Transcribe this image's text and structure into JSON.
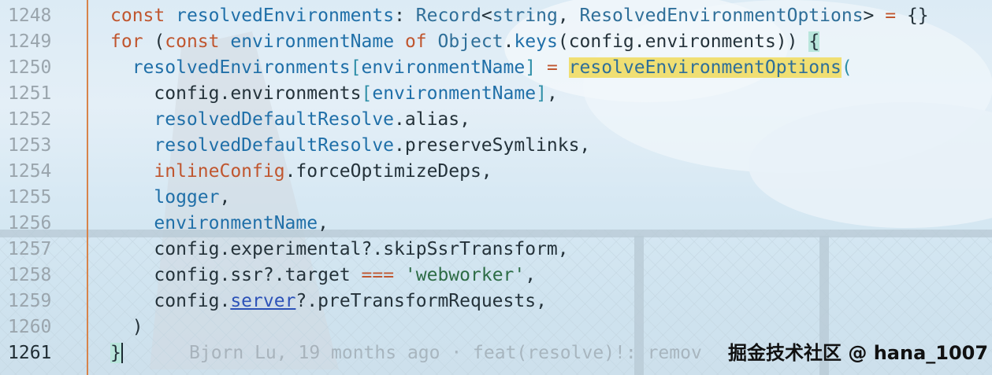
{
  "editor": {
    "lines": [
      {
        "num": "1248",
        "tokens": [
          {
            "t": "const",
            "c": "kw"
          },
          {
            "t": " ",
            "c": "pl"
          },
          {
            "t": "resolvedEnvironments",
            "c": "id"
          },
          {
            "t": ": ",
            "c": "pl"
          },
          {
            "t": "Record",
            "c": "tp"
          },
          {
            "t": "<",
            "c": "pl"
          },
          {
            "t": "string",
            "c": "tp"
          },
          {
            "t": ", ",
            "c": "pl"
          },
          {
            "t": "ResolvedEnvironmentOptions",
            "c": "tp"
          },
          {
            "t": "> ",
            "c": "pl"
          },
          {
            "t": "=",
            "c": "op"
          },
          {
            "t": " {}",
            "c": "pl"
          }
        ]
      },
      {
        "num": "1249",
        "tokens": [
          {
            "t": "for",
            "c": "kw"
          },
          {
            "t": " (",
            "c": "pl"
          },
          {
            "t": "const",
            "c": "kw"
          },
          {
            "t": " ",
            "c": "pl"
          },
          {
            "t": "environmentName",
            "c": "id"
          },
          {
            "t": " ",
            "c": "pl"
          },
          {
            "t": "of",
            "c": "kw"
          },
          {
            "t": " ",
            "c": "pl"
          },
          {
            "t": "Object",
            "c": "tp"
          },
          {
            "t": ".",
            "c": "pl"
          },
          {
            "t": "keys",
            "c": "id"
          },
          {
            "t": "(config.environments)) ",
            "c": "pl"
          },
          {
            "t": "{",
            "c": "bm"
          }
        ]
      },
      {
        "num": "1250",
        "tokens": [
          {
            "t": "  resolvedEnvironments",
            "c": "id"
          },
          {
            "t": "[",
            "c": "br"
          },
          {
            "t": "environmentName",
            "c": "id"
          },
          {
            "t": "]",
            "c": "br"
          },
          {
            "t": " ",
            "c": "pl"
          },
          {
            "t": "=",
            "c": "op"
          },
          {
            "t": " ",
            "c": "pl"
          },
          {
            "t": "resolveEnvironmentOptions",
            "c": "hl"
          },
          {
            "t": "(",
            "c": "br"
          }
        ]
      },
      {
        "num": "1251",
        "tokens": [
          {
            "t": "    config.environments",
            "c": "pl"
          },
          {
            "t": "[",
            "c": "br"
          },
          {
            "t": "environmentName",
            "c": "id"
          },
          {
            "t": "]",
            "c": "br"
          },
          {
            "t": ",",
            "c": "pl"
          }
        ]
      },
      {
        "num": "1252",
        "tokens": [
          {
            "t": "    resolvedDefaultResolve",
            "c": "id"
          },
          {
            "t": ".alias,",
            "c": "pl"
          }
        ]
      },
      {
        "num": "1253",
        "tokens": [
          {
            "t": "    resolvedDefaultResolve",
            "c": "id"
          },
          {
            "t": ".preserveSymlinks,",
            "c": "pl"
          }
        ]
      },
      {
        "num": "1254",
        "tokens": [
          {
            "t": "    inlineConfig",
            "c": "kw"
          },
          {
            "t": ".forceOptimizeDeps,",
            "c": "pl"
          }
        ]
      },
      {
        "num": "1255",
        "tokens": [
          {
            "t": "    logger",
            "c": "id"
          },
          {
            "t": ",",
            "c": "pl"
          }
        ]
      },
      {
        "num": "1256",
        "tokens": [
          {
            "t": "    environmentName",
            "c": "id"
          },
          {
            "t": ",",
            "c": "pl"
          }
        ]
      },
      {
        "num": "1257",
        "tokens": [
          {
            "t": "    config.experimental",
            "c": "pl"
          },
          {
            "t": "?.",
            "c": "pl"
          },
          {
            "t": "skipSsrTransform,",
            "c": "pl"
          }
        ]
      },
      {
        "num": "1258",
        "tokens": [
          {
            "t": "    config.ssr",
            "c": "pl"
          },
          {
            "t": "?.",
            "c": "pl"
          },
          {
            "t": "target ",
            "c": "pl"
          },
          {
            "t": "===",
            "c": "op"
          },
          {
            "t": " ",
            "c": "pl"
          },
          {
            "t": "'webworker'",
            "c": "str"
          },
          {
            "t": ",",
            "c": "pl"
          }
        ]
      },
      {
        "num": "1259",
        "tokens": [
          {
            "t": "    config.",
            "c": "pl"
          },
          {
            "t": "server",
            "c": "svlink"
          },
          {
            "t": "?.",
            "c": "pl"
          },
          {
            "t": "preTransformRequests,",
            "c": "pl"
          }
        ]
      },
      {
        "num": "1260",
        "tokens": [
          {
            "t": "  )",
            "c": "pl"
          }
        ]
      },
      {
        "num": "1261",
        "active": true,
        "tokens": [
          {
            "t": "}",
            "c": "bm"
          }
        ]
      }
    ],
    "blame_text": "Bjorn Lu, 19 months ago · feat(resolve)!: remov",
    "watermark": "掘金技术社区 @ hana_1007"
  },
  "colors": {
    "gutter_rule": "#d7834a",
    "keyword": "#c0562f",
    "type": "#2f6f99",
    "identifier": "#1f6fa8",
    "highlight": "#f0df73",
    "bracket_match": "#b9e6dc"
  }
}
